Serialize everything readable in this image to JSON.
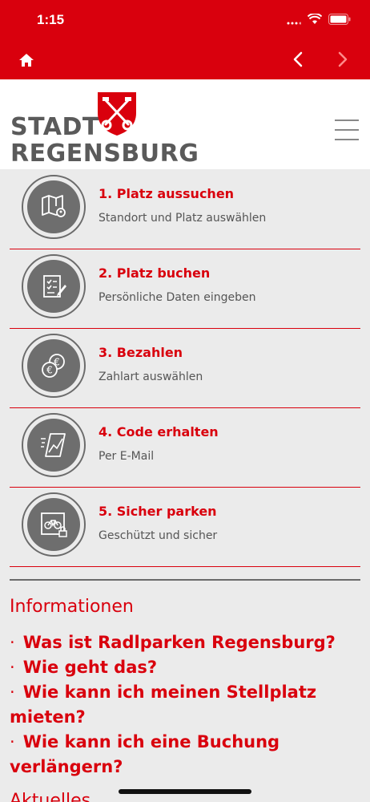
{
  "status_bar": {
    "time": "1:15"
  },
  "header": {
    "logo_line1": "STADT",
    "logo_line2": "REGENSBURG"
  },
  "steps": [
    {
      "title": "1. Platz aussuchen",
      "subtitle": "Standort und Platz auswählen",
      "icon": "map-pin-icon"
    },
    {
      "title": "2. Platz buchen",
      "subtitle": "Persönliche Daten eingeben",
      "icon": "checklist-icon"
    },
    {
      "title": "3. Bezahlen",
      "subtitle": "Zahlart auswählen",
      "icon": "euro-coins-icon"
    },
    {
      "title": "4. Code erhalten",
      "subtitle": "Per E-Mail",
      "icon": "mail-code-icon"
    },
    {
      "title": "5. Sicher parken",
      "subtitle": "Geschützt und sicher",
      "icon": "bike-lock-icon"
    }
  ],
  "info": {
    "title": "Informationen",
    "links": [
      "Was ist Radlparken Regensburg?",
      "Wie geht das?",
      "Wie kann ich meinen Stellplatz mieten?",
      "Wie kann ich eine Buchung verlängern?"
    ]
  },
  "aktuell": "Aktuelles",
  "colors": {
    "brand_red": "#d9000d",
    "gray": "#6e6e6e",
    "background": "#ebebeb"
  }
}
